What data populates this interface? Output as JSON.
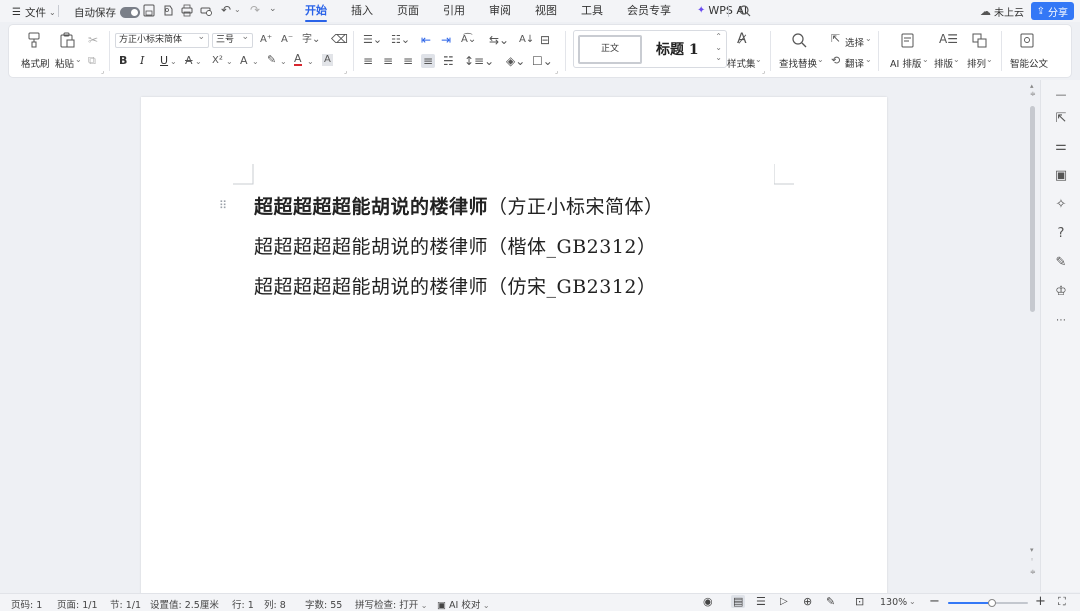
{
  "menubar": {
    "menu_icon": "hamburger-icon",
    "file_label": "文件",
    "autosave_label": "自动保存",
    "tabs": [
      "开始",
      "插入",
      "页面",
      "引用",
      "审阅",
      "视图",
      "工具",
      "会员专享",
      "WPS AI"
    ],
    "active_tab": "开始",
    "cloud_label": "未上云",
    "share_label": "分享",
    "accent_color": "#2a63e8"
  },
  "ribbon": {
    "format_painter": "格式刷",
    "paste": "粘贴",
    "font_name": "方正小标宋简体",
    "font_size": "三号",
    "bold": "B",
    "italic": "I",
    "underline": "U",
    "style_normal": "正文",
    "style_heading": "标题 1",
    "style_set": "样式集",
    "find_replace": "查找替换",
    "select": "选择",
    "translate": "翻译",
    "ai_layout": "AI 排版",
    "layout": "排版",
    "arrange": "排列",
    "smart_doc": "智能公文"
  },
  "document": {
    "lines": [
      {
        "text": "超超超超超能胡说的楼律师",
        "paren": "（方正小标宋简体）"
      },
      {
        "text": "超超超超超能胡说的楼律师",
        "paren": "（楷体_GB2312）"
      },
      {
        "text": "超超超超超能胡说的楼律师",
        "paren": "（仿宋_GB2312）"
      }
    ]
  },
  "statusbar": {
    "page_num": "页码: 1",
    "pages": "页面: 1/1",
    "section": "节: 1/1",
    "setting": "设置值: 2.5厘米",
    "row": "行: 1",
    "col": "列: 8",
    "word_count": "字数: 55",
    "spell_check": "拼写检查: 打开",
    "ai_proofread": "AI 校对",
    "zoom": "130%",
    "zoom_level": 0.55
  }
}
